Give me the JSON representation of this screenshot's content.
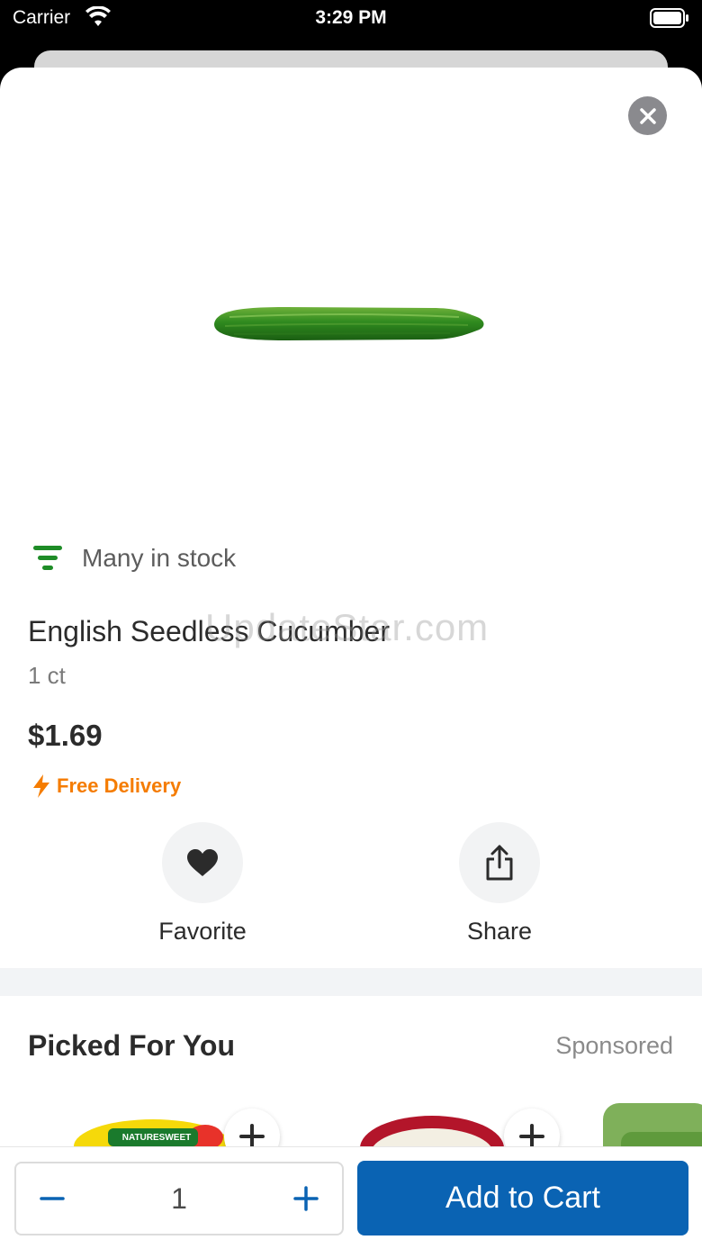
{
  "status_bar": {
    "carrier": "Carrier",
    "time": "3:29 PM"
  },
  "product": {
    "stock_status": "Many in stock",
    "title": "English Seedless Cucumber",
    "count": "1 ct",
    "price": "$1.69",
    "delivery": "Free Delivery"
  },
  "watermark": "UpdateStar.com",
  "actions": {
    "favorite_label": "Favorite",
    "share_label": "Share"
  },
  "recommendations": {
    "title": "Picked For You",
    "sponsored_label": "Sponsored",
    "item1_brand": "NATURESWEET"
  },
  "footer": {
    "quantity": "1",
    "add_to_cart_label": "Add to Cart"
  },
  "colors": {
    "primary": "#0a63b3",
    "delivery_orange": "#f57c00",
    "stock_green": "#1e8c27"
  },
  "icons": [
    "wifi-icon",
    "battery-icon",
    "close-icon",
    "stock-icon",
    "lightning-icon",
    "heart-icon",
    "share-icon",
    "plus-icon",
    "minus-icon"
  ]
}
